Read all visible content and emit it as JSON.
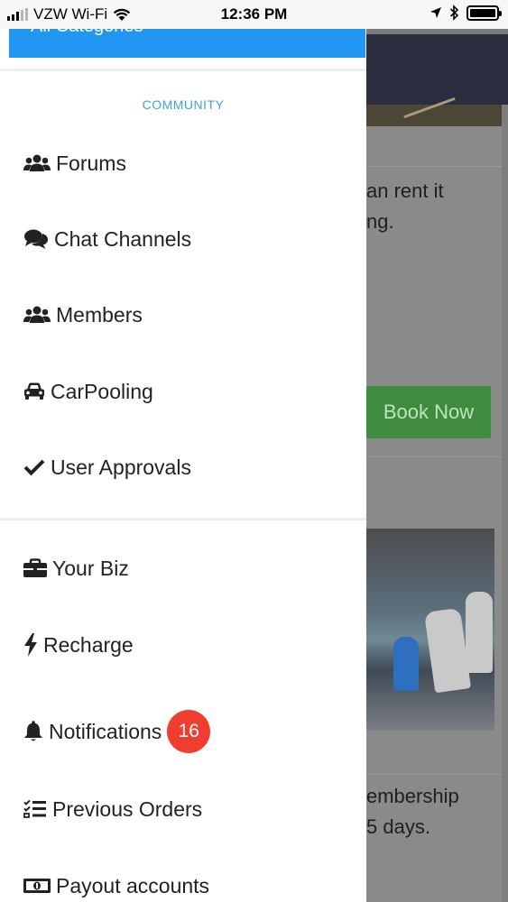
{
  "status_bar": {
    "carrier": "VZW Wi-Fi",
    "time": "12:36 PM"
  },
  "drawer": {
    "top_button_label": "All Categories",
    "section_title": "COMMUNITY",
    "community_items": [
      {
        "label": "Forums",
        "icon": "users-icon"
      },
      {
        "label": "Chat Channels",
        "icon": "comments-icon"
      },
      {
        "label": "Members",
        "icon": "users-icon"
      },
      {
        "label": "CarPooling",
        "icon": "car-icon"
      },
      {
        "label": "User Approvals",
        "icon": "check-icon"
      }
    ],
    "other_items": [
      {
        "label": "Your Biz",
        "icon": "briefcase-icon"
      },
      {
        "label": "Recharge",
        "icon": "bolt-icon"
      },
      {
        "label": "Notifications",
        "icon": "bell-icon",
        "badge": "16"
      },
      {
        "label": "Previous Orders",
        "icon": "checklist-icon"
      },
      {
        "label": "Payout accounts",
        "icon": "money-icon"
      }
    ]
  },
  "background": {
    "text_line_1": "an rent it",
    "text_line_2": "ng.",
    "book_button": "Book Now",
    "text_line_3": "embership",
    "text_line_4": "5 days."
  },
  "colors": {
    "accent": "#2196f3",
    "section_title": "#3da3d6",
    "badge": "#ef3e30",
    "book_button": "#3f8c3e"
  }
}
